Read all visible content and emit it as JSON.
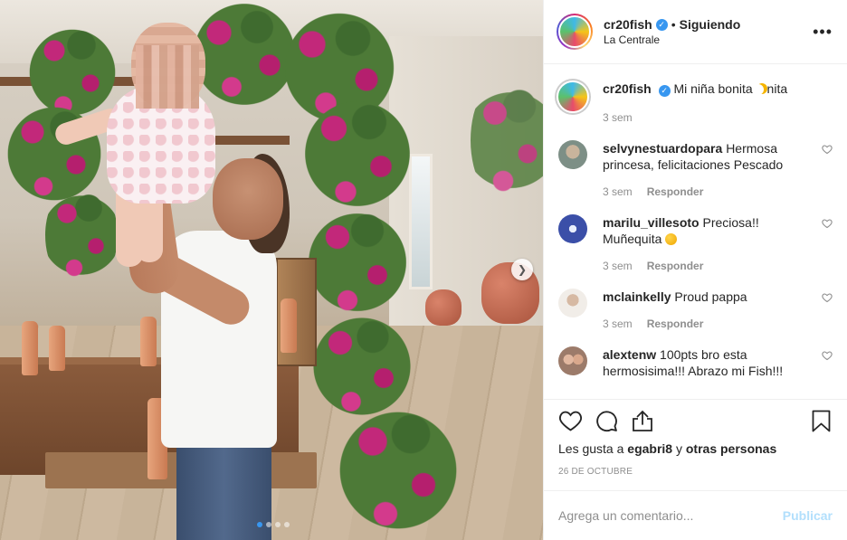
{
  "post": {
    "username": "cr20fish",
    "separator": "•",
    "follow_status": "Siguiendo",
    "location": "La Centrale",
    "more_icon": "more-options-icon",
    "carousel": {
      "total_slides": 4,
      "active_slide": 1
    }
  },
  "caption": {
    "username": "cr20fish",
    "text": "Mi niña bonita ",
    "emoji": "crescent-moon",
    "suffix": "nita",
    "time": "3 sem"
  },
  "comments": [
    {
      "username": "selvynestuardopara",
      "text": "Hermosa princesa, felicitaciones Pescado",
      "time": "3 sem",
      "reply": "Responder",
      "avatar_color": "#9aa7a0"
    },
    {
      "username": "marilu_villesoto",
      "text": "Preciosa!! Muñequita ",
      "emoji": "winking-face",
      "time": "3 sem",
      "reply": "Responder",
      "avatar_color": "#3b4fa8"
    },
    {
      "username": "mclainkelly",
      "text": "Proud pappa",
      "time": "3 sem",
      "reply": "Responder",
      "avatar_color": "#7a6c60"
    },
    {
      "username": "alextenw",
      "text": "100pts bro esta hermosisima!!! Abrazo mi Fish!!!",
      "time": "",
      "reply": "",
      "avatar_color": "#b98d7a"
    }
  ],
  "actions": {
    "likes_prefix": "Les gusta a ",
    "likes_user": "egabri8",
    "likes_middle": " y ",
    "likes_others": "otras personas",
    "date": "26 DE OCTUBRE"
  },
  "add_comment": {
    "placeholder": "Agrega un comentario...",
    "publish_label": "Publicar"
  },
  "colors": {
    "verified": "#3897f0",
    "publish_disabled": "#b2dffc",
    "meta_gray": "#8e8e8e"
  }
}
